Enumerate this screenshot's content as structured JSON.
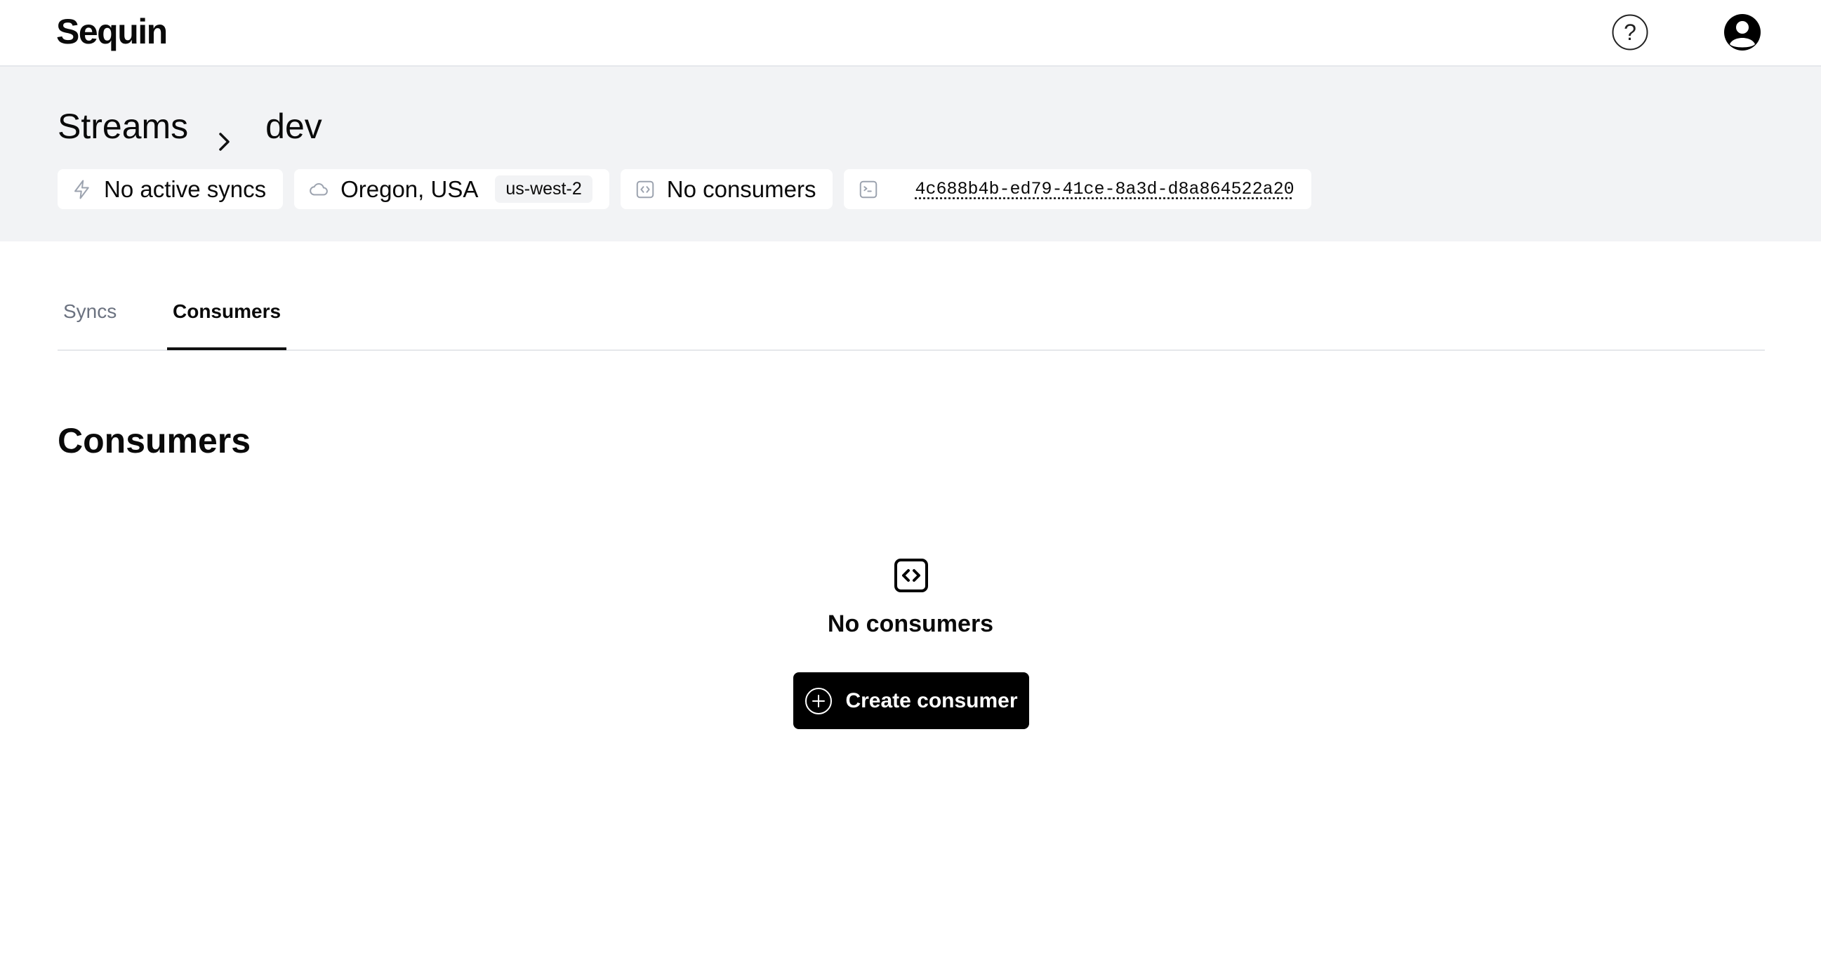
{
  "app": {
    "logo_text": "Sequin"
  },
  "header": {
    "help_icon": "help-circle-icon",
    "profile_icon": "user-circle-icon"
  },
  "breadcrumb": {
    "parent": "Streams",
    "current": "dev",
    "separator_icon": "chevron-right-icon"
  },
  "chips": {
    "syncs": {
      "icon": "zap-icon",
      "label": "No active syncs"
    },
    "region": {
      "icon": "cloud-icon",
      "label": "Oregon, USA",
      "badge": "us-west-2"
    },
    "consumers": {
      "icon": "code-square-icon",
      "label": "No consumers"
    },
    "connection": {
      "icon": "terminal-square-icon",
      "id": "4c688b4b-ed79-41ce-8a3d-d8a864522a20"
    }
  },
  "tabs": [
    {
      "label": "Syncs",
      "active": false
    },
    {
      "label": "Consumers",
      "active": true
    }
  ],
  "section": {
    "title": "Consumers"
  },
  "empty_state": {
    "icon": "code-square-icon",
    "title": "No consumers",
    "button_label": "Create consumer",
    "button_icon": "plus-circle-icon"
  },
  "colors": {
    "hero_background": "#f2f3f5",
    "primary_button": "#000000",
    "inactive_tab": "#6b7280"
  }
}
